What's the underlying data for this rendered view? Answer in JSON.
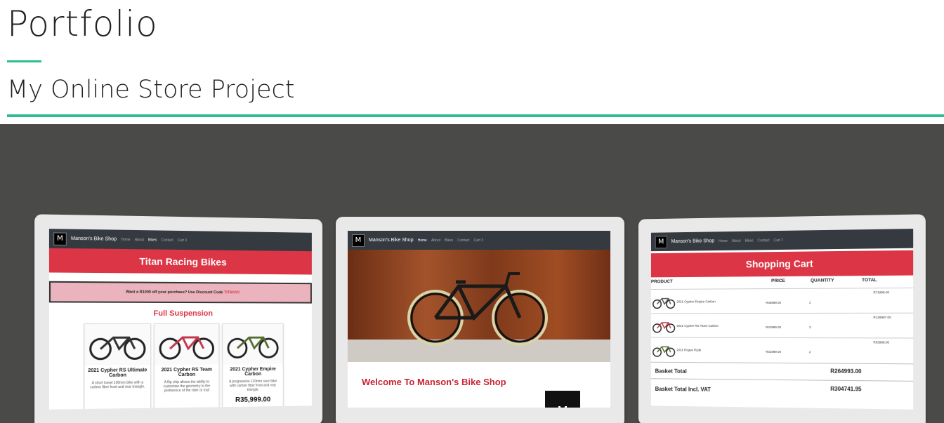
{
  "page": {
    "title": "Portfolio",
    "subtitle": "My Online Store Project",
    "accent_color": "#2dbd8f"
  },
  "shop": {
    "brand": "Manson's Bike Shop",
    "logo_letter": "M"
  },
  "screens": {
    "bikes": {
      "nav": [
        "Home",
        "About",
        "Bikes",
        "Contact",
        "Cart 3"
      ],
      "banner": "Titan Racing Bikes",
      "promo_text": "Want a R1000 off your purchase? Use Discount Code",
      "promo_code": "TITANYI!",
      "section": "Full Suspension",
      "products": [
        {
          "name": "2021 Cypher RS Ultimate Carbon",
          "desc": "A short travel 100mm bike with a carbon fiber front and rear triangle.",
          "price": ""
        },
        {
          "name": "2021 Cypher RS Team Carbon",
          "desc": "A flip chip allows the ability to customise the geometry to the preference of the rider or trail",
          "price": ""
        },
        {
          "name": "2021 Cypher Empire Carbon",
          "desc": "A progressive 120mm race bike with carbon fiber front and rear triangle.",
          "price": "R35,999.00"
        }
      ]
    },
    "home": {
      "nav": [
        "Home",
        "About",
        "Bikes",
        "Contact",
        "Cart 3"
      ],
      "welcome": "Welcome To Manson's Bike Shop"
    },
    "cart": {
      "nav": [
        "Home",
        "About",
        "Bikes",
        "Contact",
        "Cart 7"
      ],
      "banner": "Shopping Cart",
      "columns": [
        "PRODUCT",
        "PRICE",
        "QUANTITY",
        "TOTAL"
      ],
      "rows": [
        {
          "name": "2021 Cypher Empire Carbon",
          "price": "R35999.00",
          "qty": "2",
          "total": "R71998.00"
        },
        {
          "name": "2021 Cypher RS Team Carbon",
          "price": "R42999.00",
          "qty": "3",
          "total": "R128997.00"
        },
        {
          "name": "2021 Rogue Ryde",
          "price": "R31999.00",
          "qty": "2",
          "total": "R63998.00"
        }
      ],
      "basket_total_label": "Basket Total",
      "basket_total": "R264993.00",
      "basket_vat_label": "Basket Total Incl. VAT",
      "basket_vat": "R304741.95"
    }
  }
}
